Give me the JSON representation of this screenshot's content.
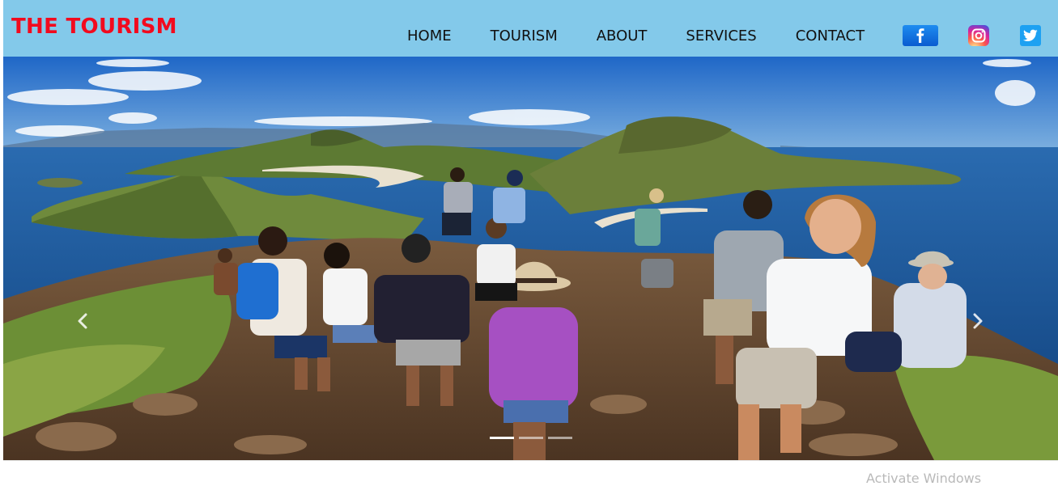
{
  "brand": {
    "title": "THE TOURISM"
  },
  "nav": {
    "items": [
      {
        "label": "HOME"
      },
      {
        "label": "TOURISM"
      },
      {
        "label": "ABOUT"
      },
      {
        "label": "SERVICES"
      },
      {
        "label": "CONTACT"
      }
    ]
  },
  "social": [
    {
      "icon": "facebook-icon",
      "glyph": "f",
      "color": "#1877f2"
    },
    {
      "icon": "instagram-icon",
      "color": "#d6249f"
    },
    {
      "icon": "twitter-icon",
      "color": "#1da1f2"
    }
  ],
  "hero": {
    "image": "tourists-on-island-hilltop-photo",
    "prev_icon": "chevron-left-icon",
    "next_icon": "chevron-right-icon",
    "slides": 3,
    "active_slide": 1
  },
  "overlay": {
    "watermark": "Activate Windows"
  },
  "colors": {
    "navbar": "#83c9ea",
    "brand": "#f20a1e",
    "nav_text": "#111111"
  }
}
